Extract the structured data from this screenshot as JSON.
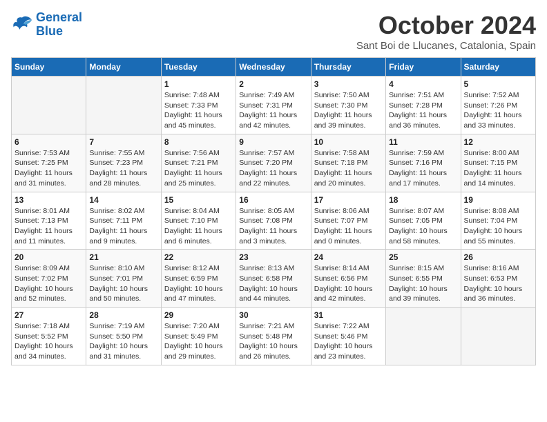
{
  "logo": {
    "line1": "General",
    "line2": "Blue"
  },
  "title": "October 2024",
  "location": "Sant Boi de Llucanes, Catalonia, Spain",
  "headers": [
    "Sunday",
    "Monday",
    "Tuesday",
    "Wednesday",
    "Thursday",
    "Friday",
    "Saturday"
  ],
  "weeks": [
    [
      {
        "day": "",
        "detail": ""
      },
      {
        "day": "",
        "detail": ""
      },
      {
        "day": "1",
        "detail": "Sunrise: 7:48 AM\nSunset: 7:33 PM\nDaylight: 11 hours and 45 minutes."
      },
      {
        "day": "2",
        "detail": "Sunrise: 7:49 AM\nSunset: 7:31 PM\nDaylight: 11 hours and 42 minutes."
      },
      {
        "day": "3",
        "detail": "Sunrise: 7:50 AM\nSunset: 7:30 PM\nDaylight: 11 hours and 39 minutes."
      },
      {
        "day": "4",
        "detail": "Sunrise: 7:51 AM\nSunset: 7:28 PM\nDaylight: 11 hours and 36 minutes."
      },
      {
        "day": "5",
        "detail": "Sunrise: 7:52 AM\nSunset: 7:26 PM\nDaylight: 11 hours and 33 minutes."
      }
    ],
    [
      {
        "day": "6",
        "detail": "Sunrise: 7:53 AM\nSunset: 7:25 PM\nDaylight: 11 hours and 31 minutes."
      },
      {
        "day": "7",
        "detail": "Sunrise: 7:55 AM\nSunset: 7:23 PM\nDaylight: 11 hours and 28 minutes."
      },
      {
        "day": "8",
        "detail": "Sunrise: 7:56 AM\nSunset: 7:21 PM\nDaylight: 11 hours and 25 minutes."
      },
      {
        "day": "9",
        "detail": "Sunrise: 7:57 AM\nSunset: 7:20 PM\nDaylight: 11 hours and 22 minutes."
      },
      {
        "day": "10",
        "detail": "Sunrise: 7:58 AM\nSunset: 7:18 PM\nDaylight: 11 hours and 20 minutes."
      },
      {
        "day": "11",
        "detail": "Sunrise: 7:59 AM\nSunset: 7:16 PM\nDaylight: 11 hours and 17 minutes."
      },
      {
        "day": "12",
        "detail": "Sunrise: 8:00 AM\nSunset: 7:15 PM\nDaylight: 11 hours and 14 minutes."
      }
    ],
    [
      {
        "day": "13",
        "detail": "Sunrise: 8:01 AM\nSunset: 7:13 PM\nDaylight: 11 hours and 11 minutes."
      },
      {
        "day": "14",
        "detail": "Sunrise: 8:02 AM\nSunset: 7:11 PM\nDaylight: 11 hours and 9 minutes."
      },
      {
        "day": "15",
        "detail": "Sunrise: 8:04 AM\nSunset: 7:10 PM\nDaylight: 11 hours and 6 minutes."
      },
      {
        "day": "16",
        "detail": "Sunrise: 8:05 AM\nSunset: 7:08 PM\nDaylight: 11 hours and 3 minutes."
      },
      {
        "day": "17",
        "detail": "Sunrise: 8:06 AM\nSunset: 7:07 PM\nDaylight: 11 hours and 0 minutes."
      },
      {
        "day": "18",
        "detail": "Sunrise: 8:07 AM\nSunset: 7:05 PM\nDaylight: 10 hours and 58 minutes."
      },
      {
        "day": "19",
        "detail": "Sunrise: 8:08 AM\nSunset: 7:04 PM\nDaylight: 10 hours and 55 minutes."
      }
    ],
    [
      {
        "day": "20",
        "detail": "Sunrise: 8:09 AM\nSunset: 7:02 PM\nDaylight: 10 hours and 52 minutes."
      },
      {
        "day": "21",
        "detail": "Sunrise: 8:10 AM\nSunset: 7:01 PM\nDaylight: 10 hours and 50 minutes."
      },
      {
        "day": "22",
        "detail": "Sunrise: 8:12 AM\nSunset: 6:59 PM\nDaylight: 10 hours and 47 minutes."
      },
      {
        "day": "23",
        "detail": "Sunrise: 8:13 AM\nSunset: 6:58 PM\nDaylight: 10 hours and 44 minutes."
      },
      {
        "day": "24",
        "detail": "Sunrise: 8:14 AM\nSunset: 6:56 PM\nDaylight: 10 hours and 42 minutes."
      },
      {
        "day": "25",
        "detail": "Sunrise: 8:15 AM\nSunset: 6:55 PM\nDaylight: 10 hours and 39 minutes."
      },
      {
        "day": "26",
        "detail": "Sunrise: 8:16 AM\nSunset: 6:53 PM\nDaylight: 10 hours and 36 minutes."
      }
    ],
    [
      {
        "day": "27",
        "detail": "Sunrise: 7:18 AM\nSunset: 5:52 PM\nDaylight: 10 hours and 34 minutes."
      },
      {
        "day": "28",
        "detail": "Sunrise: 7:19 AM\nSunset: 5:50 PM\nDaylight: 10 hours and 31 minutes."
      },
      {
        "day": "29",
        "detail": "Sunrise: 7:20 AM\nSunset: 5:49 PM\nDaylight: 10 hours and 29 minutes."
      },
      {
        "day": "30",
        "detail": "Sunrise: 7:21 AM\nSunset: 5:48 PM\nDaylight: 10 hours and 26 minutes."
      },
      {
        "day": "31",
        "detail": "Sunrise: 7:22 AM\nSunset: 5:46 PM\nDaylight: 10 hours and 23 minutes."
      },
      {
        "day": "",
        "detail": ""
      },
      {
        "day": "",
        "detail": ""
      }
    ]
  ]
}
